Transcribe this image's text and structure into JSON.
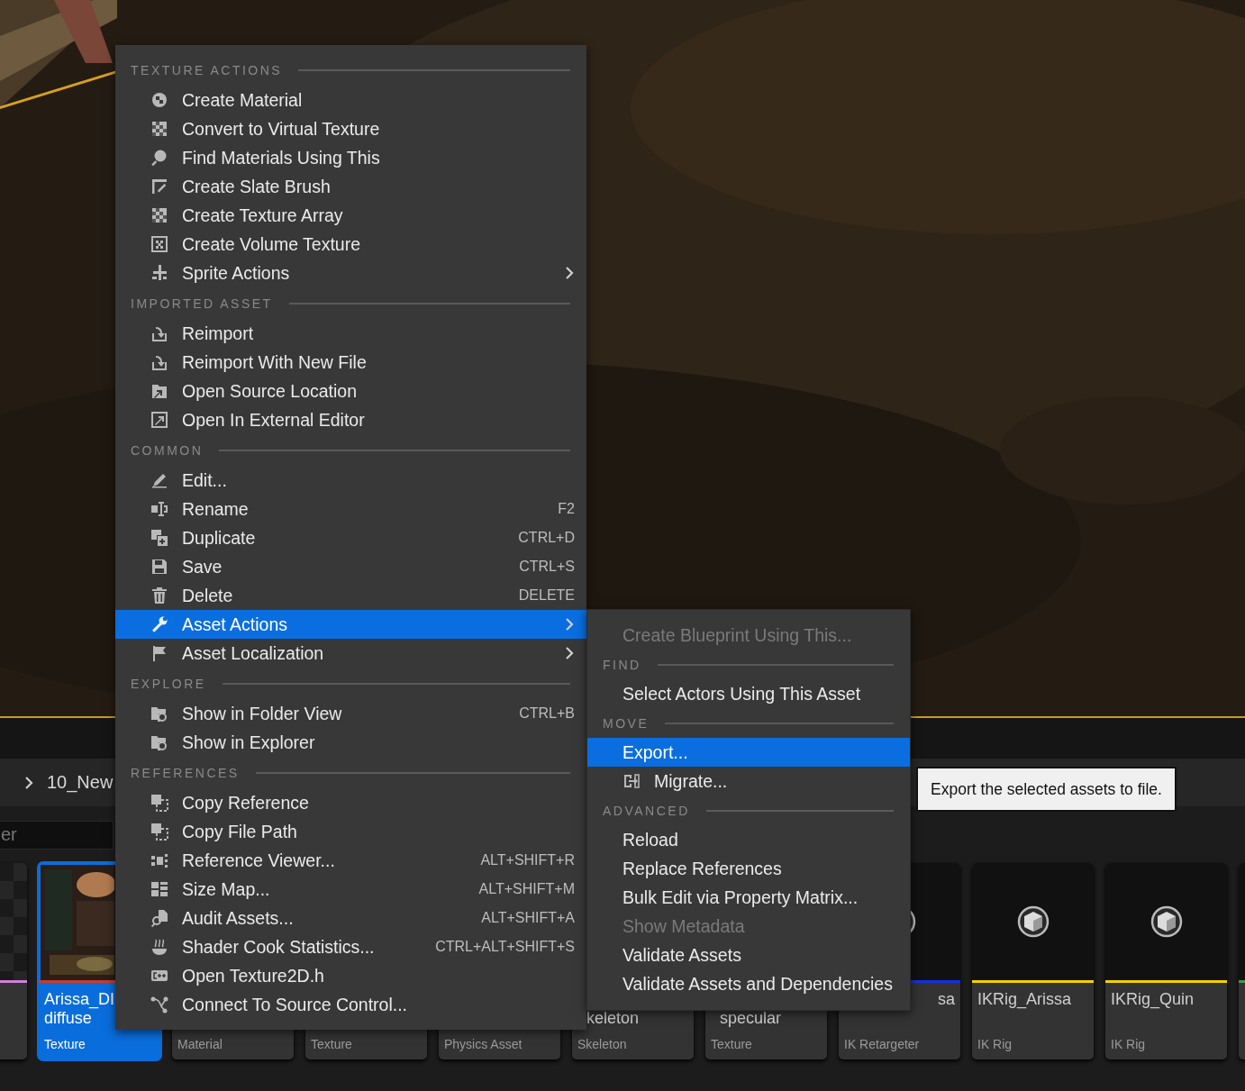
{
  "viewport": {
    "kind": "picture"
  },
  "breadcrumb": [
    "10_New"
  ],
  "search": {
    "placeholder": "er"
  },
  "tiles": [
    {
      "selected": false,
      "color": "#d080d8",
      "kind": "checker"
    },
    {
      "selected": true,
      "color": "#c83a30",
      "kind": "picture",
      "first_line_hidden": false,
      "name_right": false,
      "name_lines": [
        "Arissa_DI",
        "diffuse"
      ],
      "type": "Texture"
    },
    {
      "selected": false,
      "kind": "plain",
      "type": "Material"
    },
    {
      "selected": false,
      "kind": "plain",
      "type": "Texture"
    },
    {
      "selected": false,
      "kind": "plain",
      "type": "Physics Asset"
    },
    {
      "selected": false,
      "kind": "plain",
      "first_line_hidden": true,
      "name_right": false,
      "name_lines": [
        "keleton"
      ],
      "type": "Skeleton"
    },
    {
      "selected": false,
      "kind": "plain",
      "first_line_hidden": true,
      "name_right": false,
      "name_lines": [
        "specular"
      ],
      "type": "Texture"
    },
    {
      "selected": false,
      "color": "#1530e0",
      "kind": "cube",
      "first_line_hidden": false,
      "name_right": true,
      "name_lines": [
        "sa"
      ],
      "type": "IK Retargeter"
    },
    {
      "selected": false,
      "color": "#f2d000",
      "kind": "cube",
      "first_line_hidden": false,
      "name_right": false,
      "name_lines": [
        "IKRig_Arissa"
      ],
      "type": "IK Rig"
    },
    {
      "selected": false,
      "color": "#f2d000",
      "kind": "cube",
      "first_line_hidden": false,
      "name_right": false,
      "name_lines": [
        "IKRig_Quin"
      ],
      "type": "IK Rig"
    },
    {
      "selected": false,
      "color": "#3aa040",
      "kind": "plain"
    }
  ],
  "context_menu": {
    "sections": [
      {
        "header": "TEXTURE ACTIONS",
        "items": [
          {
            "label": "Create Material",
            "selected": false,
            "has_submenu": false
          },
          {
            "label": "Convert to Virtual Texture",
            "selected": false,
            "has_submenu": false
          },
          {
            "label": "Find Materials Using This",
            "selected": false,
            "has_submenu": false
          },
          {
            "label": "Create Slate Brush",
            "selected": false,
            "has_submenu": false
          },
          {
            "label": "Create Texture Array",
            "selected": false,
            "has_submenu": false
          },
          {
            "label": "Create Volume Texture",
            "selected": false,
            "has_submenu": false
          },
          {
            "label": "Sprite Actions",
            "selected": false,
            "has_submenu": true
          }
        ]
      },
      {
        "header": "IMPORTED ASSET",
        "items": [
          {
            "label": "Reimport",
            "selected": false,
            "has_submenu": false
          },
          {
            "label": "Reimport With New File",
            "selected": false,
            "has_submenu": false
          },
          {
            "label": "Open Source Location",
            "selected": false,
            "has_submenu": false
          },
          {
            "label": "Open In External Editor",
            "selected": false,
            "has_submenu": false
          }
        ]
      },
      {
        "header": "COMMON",
        "items": [
          {
            "label": "Edit...",
            "selected": false,
            "has_submenu": false
          },
          {
            "label": "Rename",
            "shortcut": "F2",
            "selected": false,
            "has_submenu": false
          },
          {
            "label": "Duplicate",
            "shortcut": "CTRL+D",
            "selected": false,
            "has_submenu": false
          },
          {
            "label": "Save",
            "shortcut": "CTRL+S",
            "selected": false,
            "has_submenu": false
          },
          {
            "label": "Delete",
            "shortcut": "DELETE",
            "selected": false,
            "has_submenu": false
          },
          {
            "label": "Asset Actions",
            "selected": true,
            "has_submenu": true
          },
          {
            "label": "Asset Localization",
            "selected": false,
            "has_submenu": true
          }
        ]
      },
      {
        "header": "EXPLORE",
        "items": [
          {
            "label": "Show in Folder View",
            "shortcut": "CTRL+B",
            "selected": false,
            "has_submenu": false
          },
          {
            "label": "Show in Explorer",
            "selected": false,
            "has_submenu": false
          }
        ]
      },
      {
        "header": "REFERENCES",
        "items": [
          {
            "label": "Copy Reference",
            "selected": false,
            "has_submenu": false
          },
          {
            "label": "Copy File Path",
            "selected": false,
            "has_submenu": false
          },
          {
            "label": "Reference Viewer...",
            "shortcut": "ALT+SHIFT+R",
            "selected": false,
            "has_submenu": false
          },
          {
            "label": "Size Map...",
            "shortcut": "ALT+SHIFT+M",
            "selected": false,
            "has_submenu": false
          },
          {
            "label": "Audit Assets...",
            "shortcut": "ALT+SHIFT+A",
            "selected": false,
            "has_submenu": false
          },
          {
            "label": "Shader Cook Statistics...",
            "shortcut": "CTRL+ALT+SHIFT+S",
            "selected": false,
            "has_submenu": false
          },
          {
            "label": "Open Texture2D.h",
            "selected": false,
            "has_submenu": false
          },
          {
            "label": "Connect To Source Control...",
            "selected": false,
            "has_submenu": false
          }
        ]
      }
    ]
  },
  "submenu": {
    "sections": [
      {
        "items": [
          {
            "label": "Create Blueprint Using This...",
            "selected": false,
            "disabled": true,
            "icon": false
          }
        ]
      },
      {
        "header": "FIND",
        "items": [
          {
            "label": "Select Actors Using This Asset",
            "selected": false,
            "disabled": false,
            "icon": false
          }
        ]
      },
      {
        "header": "MOVE",
        "items": [
          {
            "label": "Export...",
            "selected": true,
            "disabled": false,
            "icon": false
          },
          {
            "label": "Migrate...",
            "selected": false,
            "disabled": false,
            "icon": true
          }
        ]
      },
      {
        "header": "ADVANCED",
        "items": [
          {
            "label": "Reload",
            "selected": false,
            "disabled": false,
            "icon": false
          },
          {
            "label": "Replace References",
            "selected": false,
            "disabled": false,
            "icon": false
          },
          {
            "label": "Bulk Edit via Property Matrix...",
            "selected": false,
            "disabled": false,
            "icon": false
          },
          {
            "label": "Show Metadata",
            "selected": false,
            "disabled": true,
            "icon": false
          },
          {
            "label": "Validate Assets",
            "selected": false,
            "disabled": false,
            "icon": false
          },
          {
            "label": "Validate Assets and Dependencies",
            "selected": false,
            "disabled": false,
            "icon": false
          }
        ]
      }
    ]
  },
  "tooltip": {
    "text": "Export the selected assets to file."
  }
}
